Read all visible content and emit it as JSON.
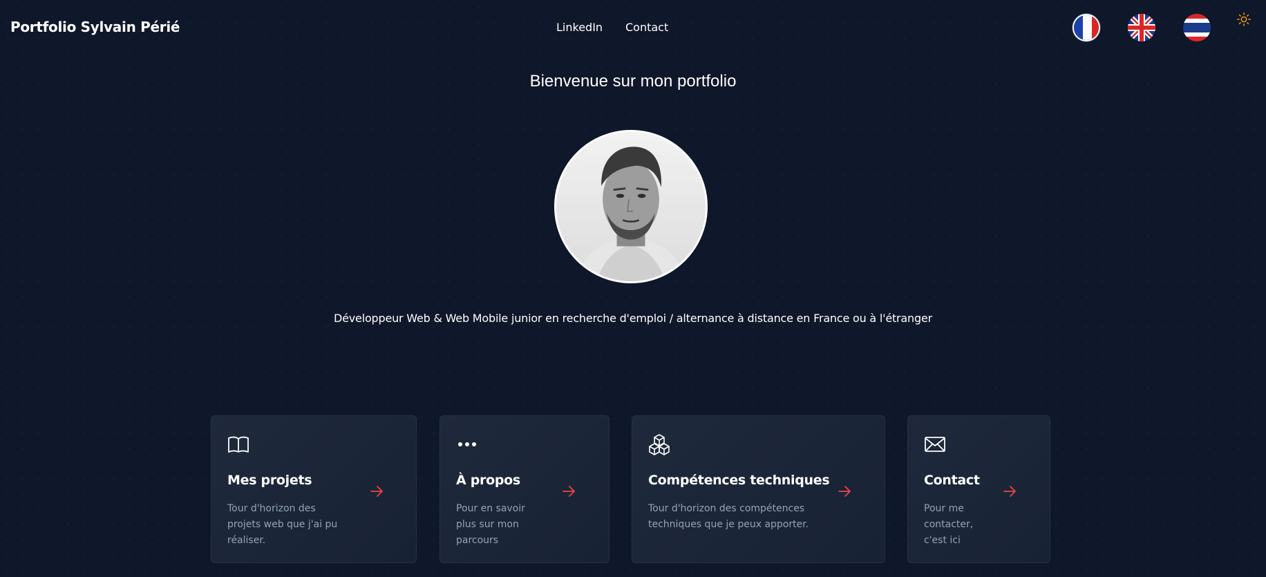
{
  "header": {
    "brand": "Portfolio Sylvain Périé",
    "nav": [
      {
        "label": "LinkedIn"
      },
      {
        "label": "Contact"
      }
    ],
    "languages": [
      {
        "code": "fr",
        "icon": "flag-france-icon",
        "active": true
      },
      {
        "code": "en",
        "icon": "flag-uk-icon",
        "active": false
      },
      {
        "code": "th",
        "icon": "flag-thailand-icon",
        "active": false
      }
    ],
    "theme_toggle_icon": "sun-icon"
  },
  "hero": {
    "title": "Bienvenue sur mon portfolio",
    "tagline": "Développeur Web & Web Mobile junior en recherche d'emploi / alternance à distance en France ou à l'étranger"
  },
  "cards": [
    {
      "icon": "book-icon",
      "title": "Mes projets",
      "description": "Tour d'horizon des projets web que j'ai pu réaliser."
    },
    {
      "icon": "dots-icon",
      "title": "À propos",
      "description": "Pour en savoir plus sur mon parcours"
    },
    {
      "icon": "cubes-icon",
      "title": "Compétences techniques",
      "description": "Tour d'horizon des compétences techniques que je peux apporter."
    },
    {
      "icon": "envelope-icon",
      "title": "Contact",
      "description": "Pour me contacter, c'est ici"
    }
  ],
  "colors": {
    "background": "#0f172a",
    "card_background": "#1e293b",
    "accent_arrow": "#ef4444",
    "muted_text": "#94a3b8",
    "sun_icon": "#f59e0b"
  }
}
